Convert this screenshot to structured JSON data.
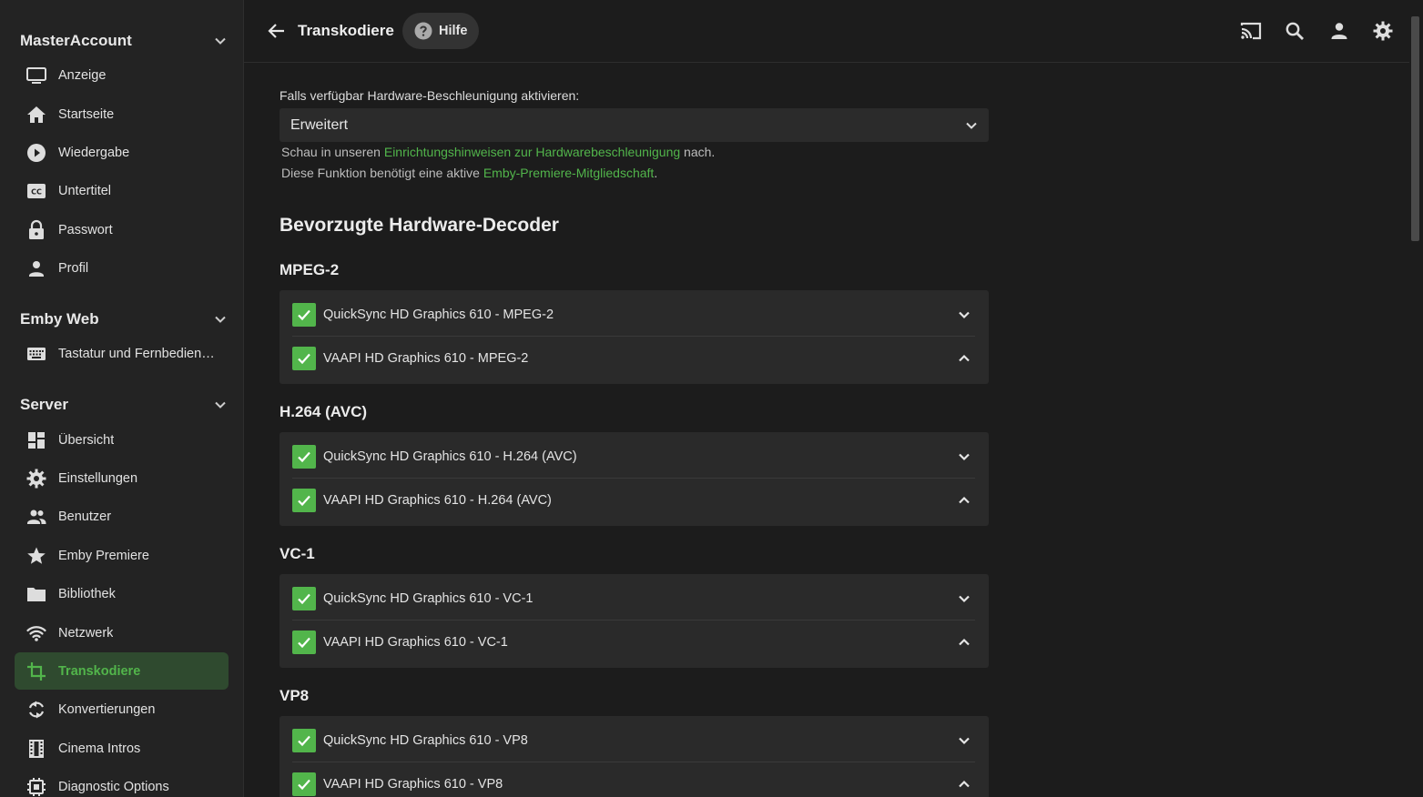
{
  "sidebar": {
    "sections": [
      {
        "title": "MasterAccount",
        "items": [
          {
            "label": "Anzeige",
            "icon": "monitor-icon"
          },
          {
            "label": "Startseite",
            "icon": "home-icon"
          },
          {
            "label": "Wiedergabe",
            "icon": "play-circle-icon"
          },
          {
            "label": "Untertitel",
            "icon": "closed-caption-icon"
          },
          {
            "label": "Passwort",
            "icon": "lock-icon"
          },
          {
            "label": "Profil",
            "icon": "person-icon"
          }
        ]
      },
      {
        "title": "Emby Web",
        "items": [
          {
            "label": "Tastatur und Fernbedienung",
            "icon": "keyboard-icon"
          }
        ]
      },
      {
        "title": "Server",
        "items": [
          {
            "label": "Übersicht",
            "icon": "dashboard-icon"
          },
          {
            "label": "Einstellungen",
            "icon": "gear-icon"
          },
          {
            "label": "Benutzer",
            "icon": "people-icon"
          },
          {
            "label": "Emby Premiere",
            "icon": "star-icon"
          },
          {
            "label": "Bibliothek",
            "icon": "folder-icon"
          },
          {
            "label": "Netzwerk",
            "icon": "wifi-icon"
          },
          {
            "label": "Transkodiere",
            "icon": "crop-icon",
            "active": true
          },
          {
            "label": "Konvertierungen",
            "icon": "sync-icon"
          },
          {
            "label": "Cinema Intros",
            "icon": "film-icon"
          },
          {
            "label": "Diagnostic Options",
            "icon": "chip-icon"
          }
        ]
      }
    ]
  },
  "header": {
    "title": "Transkodiere",
    "help_label": "Hilfe",
    "icons": [
      "cast-icon",
      "search-icon",
      "user-icon",
      "settings-icon"
    ]
  },
  "main": {
    "hw_accel_label": "Falls verfügbar Hardware-Beschleunigung aktivieren:",
    "hw_accel_value": "Erweitert",
    "hint1_prefix": "Schau in unseren ",
    "hint1_link": "Einrichtungshinweisen zur Hardwarebeschleunigung",
    "hint1_suffix": " nach.",
    "hint2_prefix": "Diese Funktion benötigt eine aktive ",
    "hint2_link": "Emby-Premiere-Mitgliedschaft",
    "hint2_suffix": ".",
    "decoders_heading": "Bevorzugte Hardware-Decoder",
    "codecs": [
      {
        "name": "MPEG-2",
        "decoders": [
          {
            "label": "QuickSync HD Graphics 610 - MPEG-2",
            "checked": true
          },
          {
            "label": "VAAPI HD Graphics 610 - MPEG-2",
            "checked": true
          }
        ]
      },
      {
        "name": "H.264 (AVC)",
        "decoders": [
          {
            "label": "QuickSync HD Graphics 610 - H.264 (AVC)",
            "checked": true
          },
          {
            "label": "VAAPI HD Graphics 610 - H.264 (AVC)",
            "checked": true
          }
        ]
      },
      {
        "name": "VC-1",
        "decoders": [
          {
            "label": "QuickSync HD Graphics 610 - VC-1",
            "checked": true
          },
          {
            "label": "VAAPI HD Graphics 610 - VC-1",
            "checked": true
          }
        ]
      },
      {
        "name": "VP8",
        "decoders": [
          {
            "label": "QuickSync HD Graphics 610 - VP8",
            "checked": true
          },
          {
            "label": "VAAPI HD Graphics 610 - VP8",
            "checked": true
          }
        ]
      }
    ]
  },
  "colors": {
    "accent": "#52b54b",
    "background": "#1c1c1c",
    "sidebar": "#232323",
    "card": "#2a2a2a"
  }
}
